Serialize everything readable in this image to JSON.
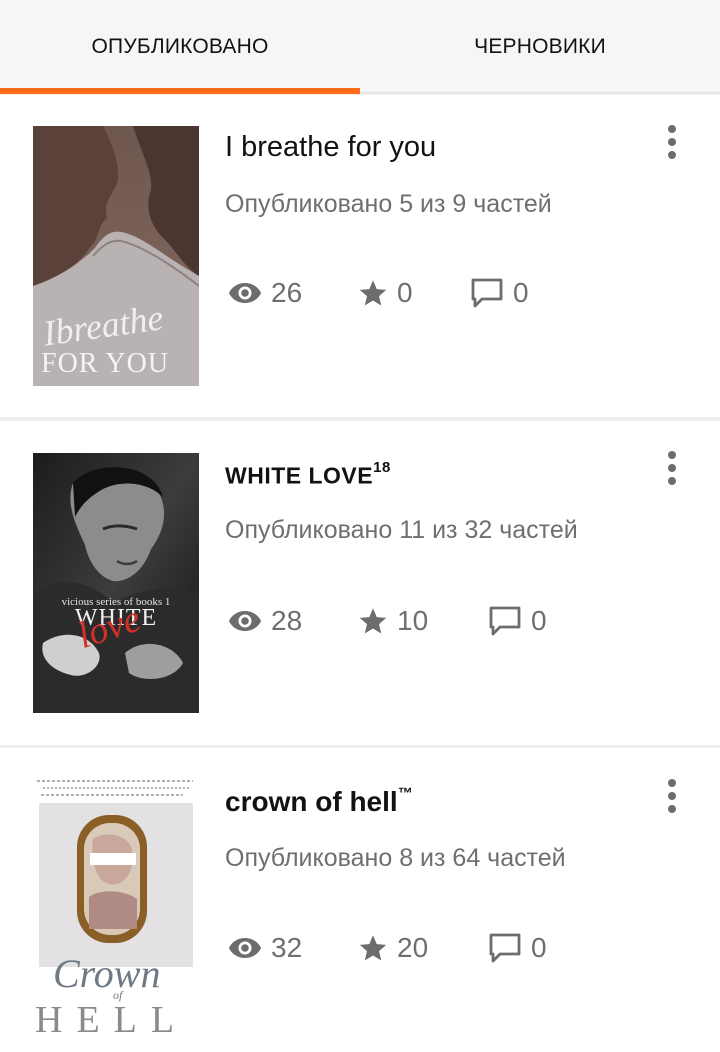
{
  "tabs": [
    {
      "label": "ОПУБЛИКОВАНО",
      "active": true
    },
    {
      "label": "ЧЕРНОВИКИ",
      "active": false
    }
  ],
  "accent_color": "#ff6a19",
  "stories": [
    {
      "title": "I breathe for you",
      "title_sup": "",
      "published": "Опубликовано 5 из 9 частей",
      "views": "26",
      "votes": "0",
      "comments": "0",
      "cover_text": [
        "Ibreathe",
        "FOR YOU"
      ]
    },
    {
      "title": "WHITE LOVE",
      "title_sup": "18",
      "published": "Опубликовано 11 из 32 частей",
      "views": "28",
      "votes": "10",
      "comments": "0",
      "cover_text": [
        "vicious series of books 1",
        "WHITE",
        "love"
      ]
    },
    {
      "title": "crown of hell",
      "title_sup": "™",
      "published": "Опубликовано 8 из 64 частей",
      "views": "32",
      "votes": "20",
      "comments": "0",
      "cover_text": [
        "Crown",
        "of",
        "HELL"
      ]
    }
  ],
  "icons": {
    "views": "eye-icon",
    "votes": "star-icon",
    "comments": "comment-icon",
    "more": "more-vertical-icon"
  }
}
